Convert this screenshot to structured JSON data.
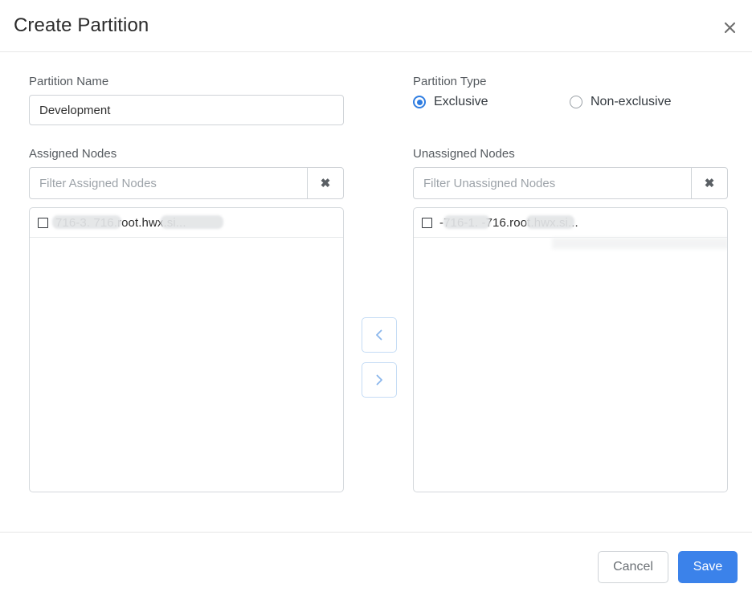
{
  "dialog": {
    "title": "Create Partition",
    "close_icon": "close-icon"
  },
  "form": {
    "partition_name": {
      "label": "Partition Name",
      "value": "Development",
      "placeholder": "Partition Name"
    },
    "partition_type": {
      "label": "Partition Type",
      "selected": "Exclusive",
      "options": [
        {
          "label": "Exclusive",
          "checked": true
        },
        {
          "label": "Non-exclusive",
          "checked": false
        }
      ]
    }
  },
  "assigned": {
    "label": "Assigned Nodes",
    "filter": {
      "value": "",
      "placeholder": "Filter Assigned Nodes"
    },
    "clear_icon": "✖",
    "nodes": [
      {
        "label": "716-3.                     716.root.hwx.si...",
        "checked": false
      }
    ]
  },
  "unassigned": {
    "label": "Unassigned Nodes",
    "filter": {
      "value": "",
      "placeholder": "Filter Unassigned Nodes"
    },
    "clear_icon": "✖",
    "nodes": [
      {
        "label": "-716-1.              -716.root.hwx.si...",
        "checked": false
      }
    ]
  },
  "transfer": {
    "move_left_icon": "chevron-left-icon",
    "move_right_icon": "chevron-right-icon"
  },
  "footer": {
    "cancel_label": "Cancel",
    "save_label": "Save"
  },
  "colors": {
    "accent": "#3b82ea",
    "radio_selected": "#2f7de1",
    "transfer_border": "#c5dcf5",
    "transfer_glyph": "#8ab6ec",
    "border": "#cfd3d7",
    "text": "#2b2b2b",
    "muted_text": "#6a6f74"
  }
}
